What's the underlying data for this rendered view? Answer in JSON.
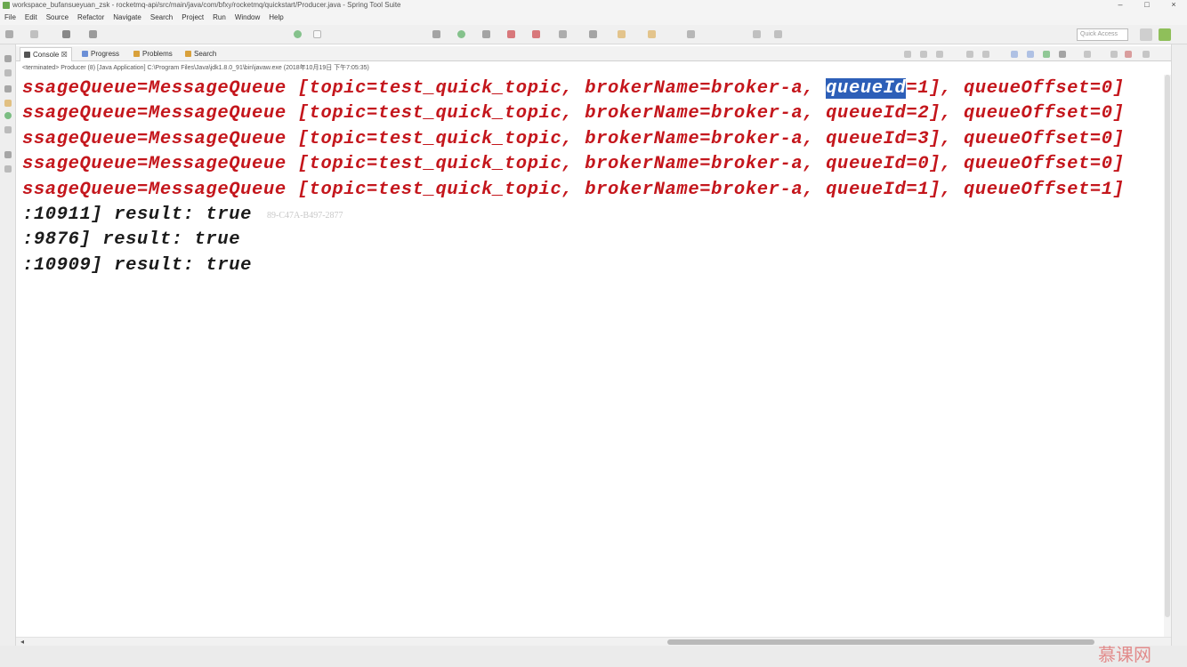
{
  "window": {
    "title": "workspace_bufansueyuan_zsk - rocketmq-api/src/main/java/com/bfxy/rocketmq/quickstart/Producer.java - Spring Tool Suite",
    "minimize": "–",
    "maximize": "□",
    "close": "×"
  },
  "menu": [
    "File",
    "Edit",
    "Source",
    "Refactor",
    "Navigate",
    "Search",
    "Project",
    "Run",
    "Window",
    "Help"
  ],
  "toolbar": {
    "quick_access_placeholder": "Quick Access"
  },
  "view_tabs": {
    "console": "Console ☒",
    "progress": "Progress",
    "problems": "Problems",
    "search": "Search"
  },
  "console_status": "<terminated> Producer (8) [Java Application] C:\\Program Files\\Java\\jdk1.8.0_91\\bin\\javaw.exe (2018年10月19日 下午7:05:35)",
  "console_lines": {
    "l1_before": "ssageQueue=MessageQueue [topic=test_quick_topic, brokerName=broker-a, ",
    "l1_selected": "queueId",
    "l1_after": "=1], queueOffset=0]",
    "l2": "ssageQueue=MessageQueue [topic=test_quick_topic, brokerName=broker-a, queueId=2], queueOffset=0]",
    "l3": "ssageQueue=MessageQueue [topic=test_quick_topic, brokerName=broker-a, queueId=3], queueOffset=0]",
    "l4": "ssageQueue=MessageQueue [topic=test_quick_topic, brokerName=broker-a, queueId=0], queueOffset=0]",
    "l5": "ssageQueue=MessageQueue [topic=test_quick_topic, brokerName=broker-a, queueId=1], queueOffset=1]",
    "l6": ":10911] result: true",
    "l7": ":9876] result: true",
    "l8": ":10909] result: true"
  },
  "overlay_text": "89-C47A-B497-2877",
  "watermark": "慕课网",
  "colors": {
    "stderr_text": "#c4161c",
    "stdout_text": "#1b1b1b",
    "selection": "#2d5fb8"
  },
  "icons": [
    "app-icon",
    "console-icon",
    "progress-icon",
    "problems-icon",
    "search-icon"
  ]
}
